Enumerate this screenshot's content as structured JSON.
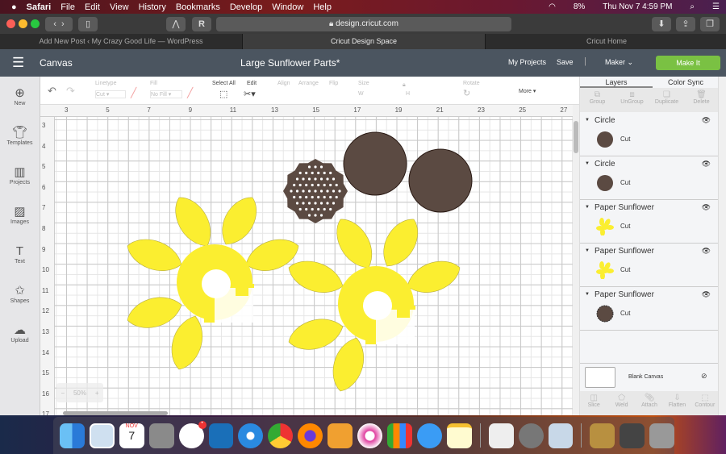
{
  "menubar": {
    "app": "Safari",
    "items": [
      "File",
      "Edit",
      "View",
      "History",
      "Bookmarks",
      "Develop",
      "Window",
      "Help"
    ],
    "battery": "8%",
    "datetime": "Thu Nov 7  4:59 PM"
  },
  "browser": {
    "url": "design.cricut.com",
    "tabs": [
      {
        "label": "Add New Post ‹ My Crazy Good Life — WordPress"
      },
      {
        "label": "Cricut Design Space",
        "active": true
      },
      {
        "label": "Cricut Home"
      }
    ],
    "new_tab": "+"
  },
  "header": {
    "section": "Canvas",
    "title": "Large Sunflower Parts*",
    "my_projects": "My Projects",
    "save": "Save",
    "machine": "Maker",
    "make_it": "Make It",
    "make_it_color": "#7ac143"
  },
  "sidebar": [
    {
      "label": "New",
      "icon": "plus-circle-icon"
    },
    {
      "label": "Templates",
      "icon": "shirt-icon"
    },
    {
      "label": "Projects",
      "icon": "notebook-icon"
    },
    {
      "label": "Images",
      "icon": "image-icon"
    },
    {
      "label": "Text",
      "icon": "text-icon"
    },
    {
      "label": "Shapes",
      "icon": "shapes-icon"
    },
    {
      "label": "Upload",
      "icon": "cloud-upload-icon"
    }
  ],
  "edit_bar": {
    "linetype_label": "Linetype",
    "linetype_value": "Cut",
    "fill_label": "Fill",
    "fill_value": "No Fill",
    "select_all": "Select All",
    "edit": "Edit",
    "align": "Align",
    "arrange": "Arrange",
    "flip": "Flip",
    "size": "Size",
    "w": "W",
    "h": "H",
    "rotate": "Rotate",
    "more": "More ▾"
  },
  "ruler": {
    "top": [
      "3",
      "5",
      "7",
      "9",
      "11",
      "13",
      "15",
      "17",
      "19",
      "21",
      "23",
      "25",
      "27"
    ],
    "left": [
      "3",
      "4",
      "5",
      "6",
      "7",
      "8",
      "9",
      "10",
      "11",
      "12",
      "13",
      "14",
      "15",
      "16",
      "17"
    ]
  },
  "zoom": {
    "level": "50%",
    "minus": "−",
    "plus": "+"
  },
  "panel": {
    "tabs": [
      "Layers",
      "Color Sync"
    ],
    "actions": [
      "Group",
      "UnGroup",
      "Duplicate",
      "Delete"
    ],
    "layers": [
      {
        "name": "Circle",
        "op": "Cut",
        "thumb": "circle"
      },
      {
        "name": "Circle",
        "op": "Cut",
        "thumb": "circle"
      },
      {
        "name": "Paper Sunflower",
        "op": "Cut",
        "thumb": "flower"
      },
      {
        "name": "Paper Sunflower",
        "op": "Cut",
        "thumb": "flower"
      },
      {
        "name": "Paper Sunflower",
        "op": "Cut",
        "thumb": "badge"
      }
    ],
    "blank_canvas": "Blank Canvas",
    "bottom_actions": [
      "Slice",
      "Weld",
      "Attach",
      "Flatten",
      "Contour"
    ]
  },
  "colors": {
    "yellow": "#fbee30",
    "brown": "#5b4a42",
    "header": "#4b5560"
  },
  "dock": {
    "calendar_month": "NOV",
    "calendar_day": "7",
    "slack_badge": "•"
  }
}
